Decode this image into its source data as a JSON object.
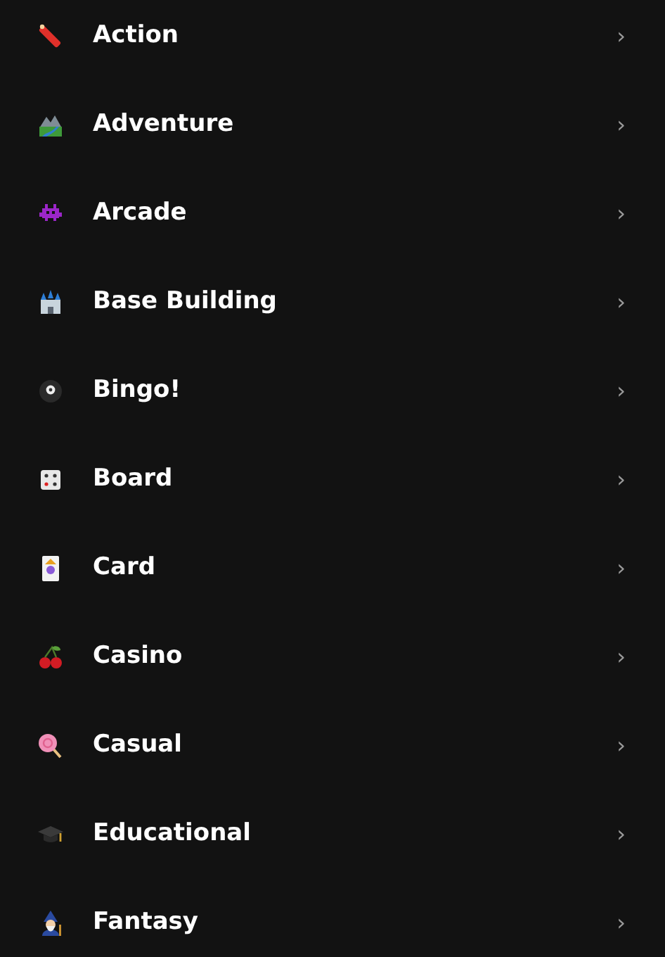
{
  "categories": [
    {
      "label": "Action"
    },
    {
      "label": "Adventure"
    },
    {
      "label": "Arcade"
    },
    {
      "label": "Base Building"
    },
    {
      "label": "Bingo!"
    },
    {
      "label": "Board"
    },
    {
      "label": "Card"
    },
    {
      "label": "Casino"
    },
    {
      "label": "Casual"
    },
    {
      "label": "Educational"
    },
    {
      "label": "Fantasy"
    }
  ],
  "chevron": "›"
}
